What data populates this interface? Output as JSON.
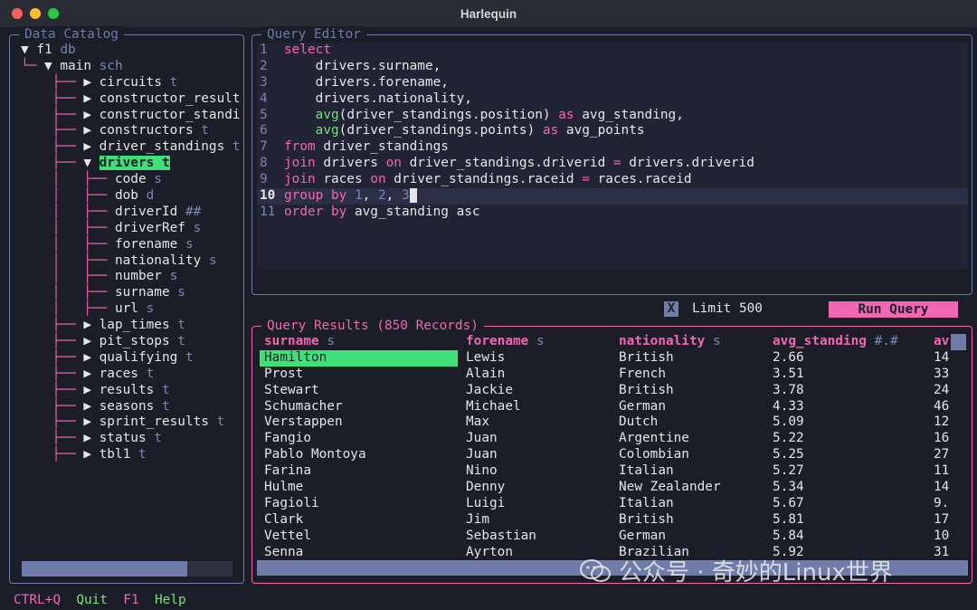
{
  "window": {
    "title": "Harlequin"
  },
  "catalog": {
    "label": "Data Catalog",
    "db": {
      "name": "f1",
      "type": "db"
    },
    "schema": {
      "name": "main",
      "type": "sch"
    },
    "tables_before": [
      {
        "name": "circuits",
        "type": "t"
      },
      {
        "name": "constructor_result",
        "type": ""
      },
      {
        "name": "constructor_standi",
        "type": ""
      },
      {
        "name": "constructors",
        "type": "t"
      },
      {
        "name": "driver_standings",
        "type": "t"
      }
    ],
    "expanded_table": {
      "name": "drivers",
      "type": "t"
    },
    "columns": [
      {
        "name": "code",
        "type": "s"
      },
      {
        "name": "dob",
        "type": "d"
      },
      {
        "name": "driverId",
        "type": "##"
      },
      {
        "name": "driverRef",
        "type": "s"
      },
      {
        "name": "forename",
        "type": "s"
      },
      {
        "name": "nationality",
        "type": "s"
      },
      {
        "name": "number",
        "type": "s"
      },
      {
        "name": "surname",
        "type": "s"
      },
      {
        "name": "url",
        "type": "s"
      }
    ],
    "tables_after": [
      {
        "name": "lap_times",
        "type": "t"
      },
      {
        "name": "pit_stops",
        "type": "t"
      },
      {
        "name": "qualifying",
        "type": "t"
      },
      {
        "name": "races",
        "type": "t"
      },
      {
        "name": "results",
        "type": "t"
      },
      {
        "name": "seasons",
        "type": "t"
      },
      {
        "name": "sprint_results",
        "type": "t"
      },
      {
        "name": "status",
        "type": "t"
      },
      {
        "name": "tbl1",
        "type": "t"
      }
    ]
  },
  "editor": {
    "label": "Query Editor",
    "current_line": 10,
    "lines": [
      [
        [
          "kw",
          "select"
        ]
      ],
      [
        [
          "",
          "    drivers.surname,"
        ]
      ],
      [
        [
          "",
          "    drivers.forename,"
        ]
      ],
      [
        [
          "",
          "    drivers.nationality,"
        ]
      ],
      [
        [
          "fn",
          "    avg"
        ],
        [
          "",
          "(driver_standings.position) "
        ],
        [
          "kw",
          "as"
        ],
        [
          "",
          " avg_standing,"
        ]
      ],
      [
        [
          "fn",
          "    avg"
        ],
        [
          "",
          "(driver_standings.points) "
        ],
        [
          "kw",
          "as"
        ],
        [
          "",
          " avg_points"
        ]
      ],
      [
        [
          "kw",
          "from"
        ],
        [
          "",
          " driver_standings"
        ]
      ],
      [
        [
          "kw",
          "join"
        ],
        [
          "",
          " drivers "
        ],
        [
          "kw",
          "on"
        ],
        [
          "",
          " driver_standings.driverid "
        ],
        [
          "kw",
          "="
        ],
        [
          "",
          " drivers.driverid"
        ]
      ],
      [
        [
          "kw",
          "join"
        ],
        [
          "",
          " races "
        ],
        [
          "kw",
          "on"
        ],
        [
          "",
          " driver_standings.raceid "
        ],
        [
          "kw",
          "="
        ],
        [
          "",
          " races.raceid"
        ]
      ],
      [
        [
          "kw",
          "group by"
        ],
        [
          "",
          " "
        ],
        [
          "num",
          "1"
        ],
        [
          "",
          ", "
        ],
        [
          "num",
          "2"
        ],
        [
          "",
          ", "
        ],
        [
          "num",
          "3"
        ],
        [
          "cursor",
          " "
        ]
      ],
      [
        [
          "kw",
          "order by"
        ],
        [
          "",
          " avg_standing asc"
        ]
      ]
    ]
  },
  "limit": {
    "checkbox": "X",
    "label": "Limit 500"
  },
  "run_button": "Run Query",
  "results": {
    "label": "Query Results (850 Records)",
    "columns": [
      {
        "name": "surname",
        "type": "s"
      },
      {
        "name": "forename",
        "type": "s"
      },
      {
        "name": "nationality",
        "type": "s"
      },
      {
        "name": "avg_standing",
        "type": "#.#"
      },
      {
        "name": "av",
        "type": ""
      }
    ],
    "rows": [
      [
        "Hamilton",
        "Lewis",
        "British",
        "2.66",
        "14"
      ],
      [
        "Prost",
        "Alain",
        "French",
        "3.51",
        "33"
      ],
      [
        "Stewart",
        "Jackie",
        "British",
        "3.78",
        "24"
      ],
      [
        "Schumacher",
        "Michael",
        "German",
        "4.33",
        "46"
      ],
      [
        "Verstappen",
        "Max",
        "Dutch",
        "5.09",
        "12"
      ],
      [
        "Fangio",
        "Juan",
        "Argentine",
        "5.22",
        "16"
      ],
      [
        "Pablo Montoya",
        "Juan",
        "Colombian",
        "5.25",
        "27"
      ],
      [
        "Farina",
        "Nino",
        "Italian",
        "5.27",
        "11"
      ],
      [
        "Hulme",
        "Denny",
        "New Zealander",
        "5.34",
        "14"
      ],
      [
        "Fagioli",
        "Luigi",
        "Italian",
        "5.67",
        "9."
      ],
      [
        "Clark",
        "Jim",
        "British",
        "5.81",
        "17"
      ],
      [
        "Vettel",
        "Sebastian",
        "German",
        "5.84",
        "10"
      ],
      [
        "Senna",
        "Ayrton",
        "Brazilian",
        "5.92",
        "31"
      ]
    ]
  },
  "statusbar": [
    {
      "key": "CTRL+Q",
      "label": "Quit"
    },
    {
      "key": "F1",
      "label": "Help"
    }
  ],
  "watermark": "公众号 · 奇妙的Linux世界",
  "colors": {
    "pink": "#f067b4",
    "green": "#3ee07a",
    "slate": "#6f7ba8",
    "bg": "#1b1d27"
  }
}
